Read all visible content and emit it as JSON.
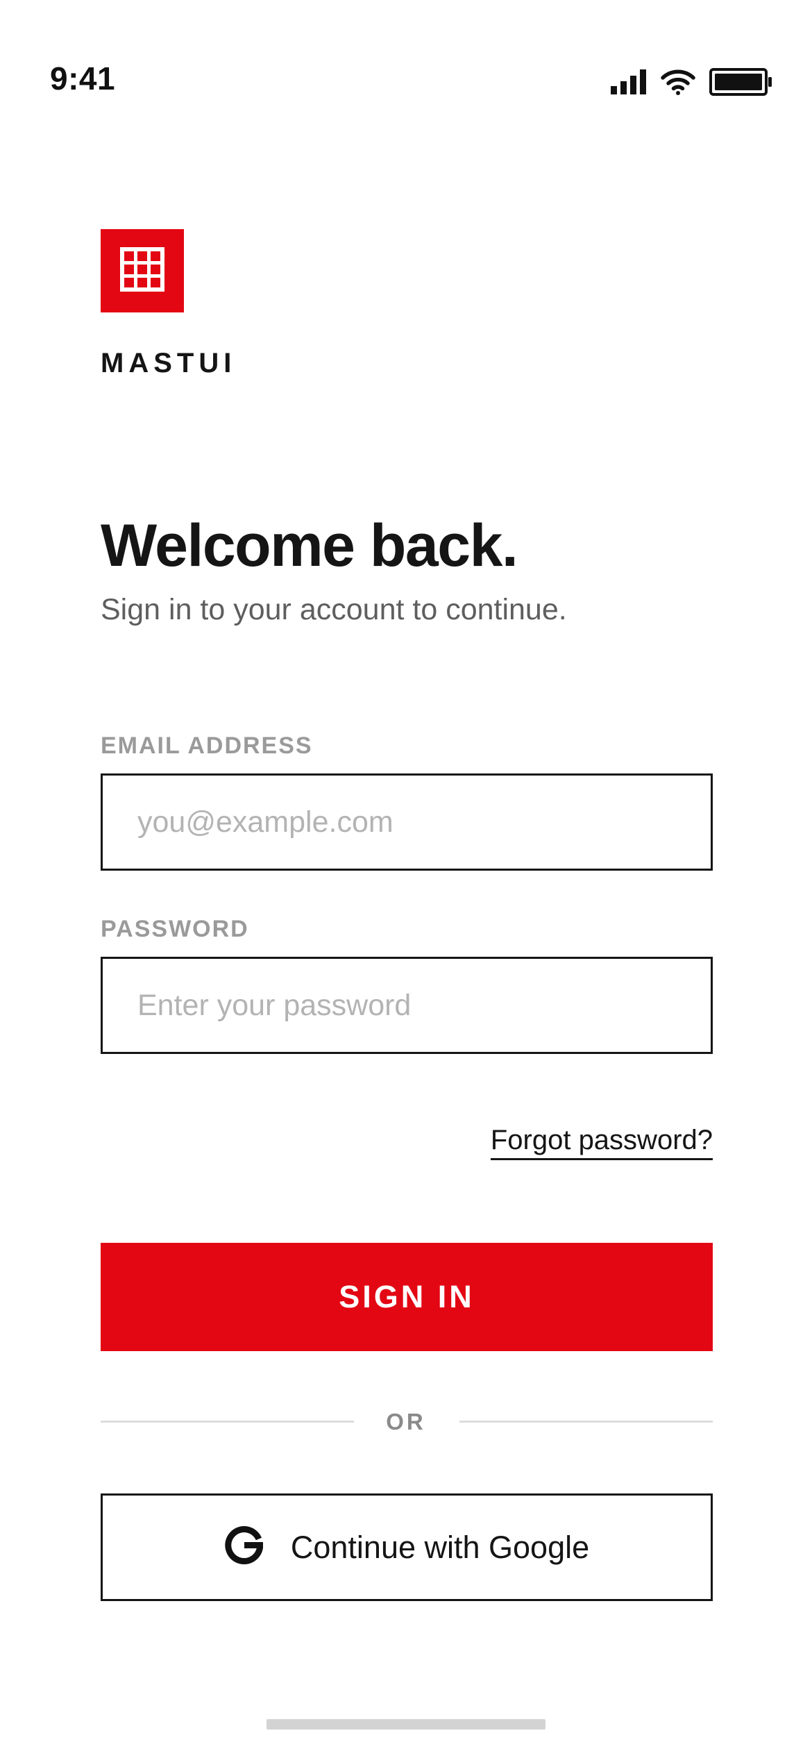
{
  "status_bar": {
    "time": "9:41",
    "icons": [
      "cellular-signal-icon",
      "wifi-icon",
      "battery-icon"
    ]
  },
  "brand": {
    "name": "MASTUI",
    "logo_icon": "grid-logo-icon",
    "accent_color": "#e30613"
  },
  "header": {
    "title": "Welcome back.",
    "subtitle": "Sign in to your account to continue."
  },
  "form": {
    "email": {
      "label": "EMAIL ADDRESS",
      "placeholder": "you@example.com",
      "value": ""
    },
    "password": {
      "label": "PASSWORD",
      "placeholder": "Enter your password",
      "value": ""
    },
    "forgot_link": "Forgot password?",
    "submit_label": "SIGN IN"
  },
  "divider": {
    "text": "OR"
  },
  "social": {
    "google_label": "Continue with Google",
    "google_icon": "google-g-icon"
  },
  "colors": {
    "text": "#151515",
    "muted": "#9a9a9a",
    "placeholder": "#b3b3b3",
    "border": "#151515",
    "divider": "#dcdcdc"
  }
}
